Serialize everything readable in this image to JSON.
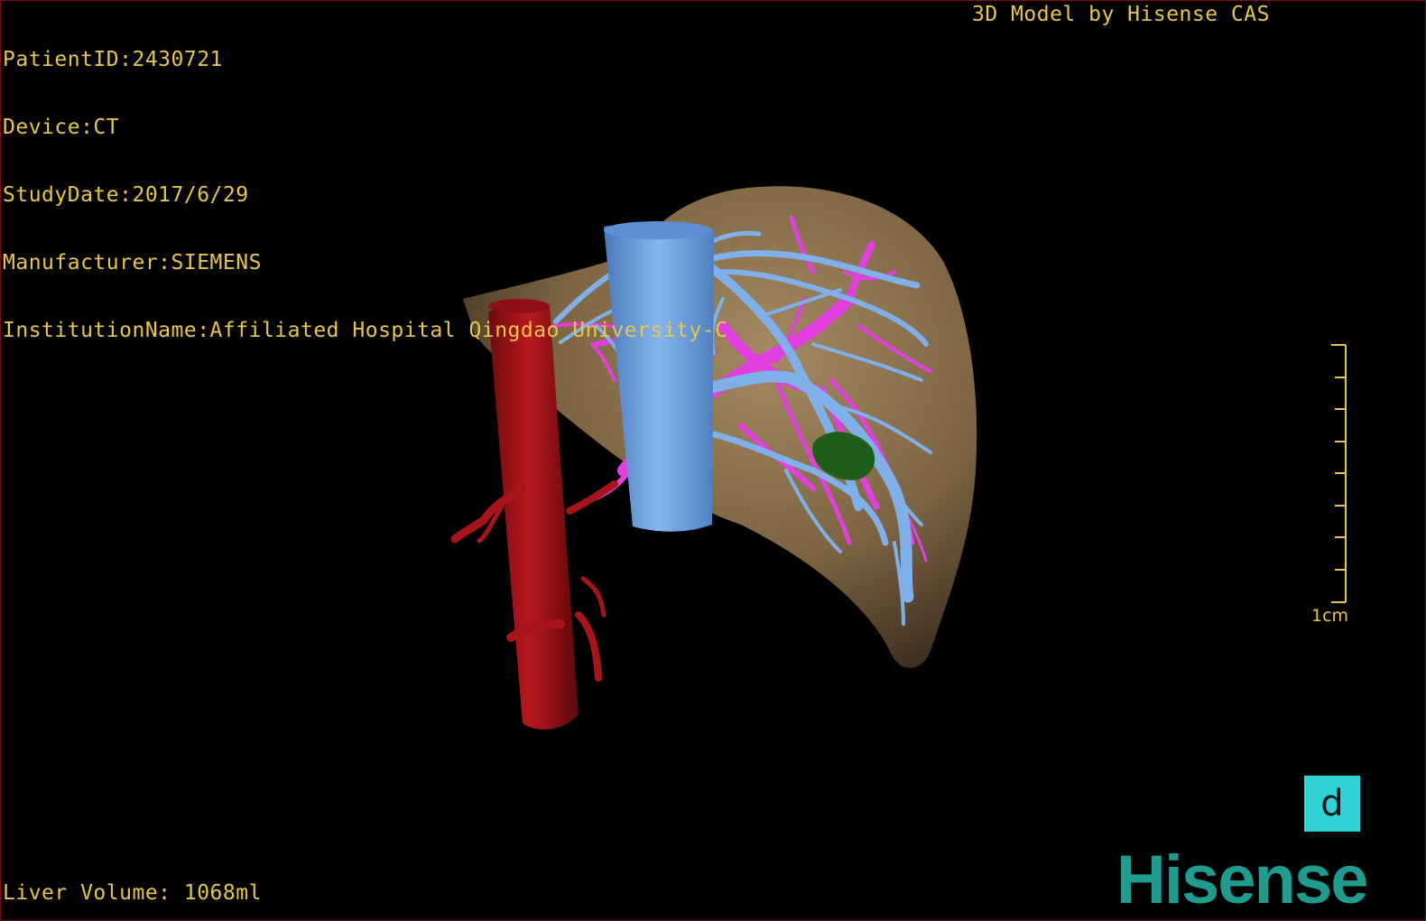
{
  "header": {
    "patient_id": "PatientID:2430721",
    "device": "Device:CT",
    "study_date": "StudyDate:2017/6/29",
    "manufacturer": "Manufacturer:SIEMENS",
    "institution": "InstitutionName:Affiliated Hospital Qingdao University-C",
    "credit": "3D Model by Hisense CAS"
  },
  "footer": {
    "liver_volume": "Liver Volume: 1068ml"
  },
  "scale_bar": {
    "label": "1cm"
  },
  "orientation_cube": {
    "label": "d"
  },
  "brand": {
    "logo_text": "Hisense"
  },
  "colors": {
    "text": "#e8c64a",
    "liver": "#8a6f4a",
    "aorta": "#a8141a",
    "vena_cava": "#6e9fe0",
    "hepatic_vein": "#e23fe0",
    "tumor": "#1d5e1a",
    "orientation_cube": "#2fd3d5",
    "brand": "#1e9c8e"
  }
}
